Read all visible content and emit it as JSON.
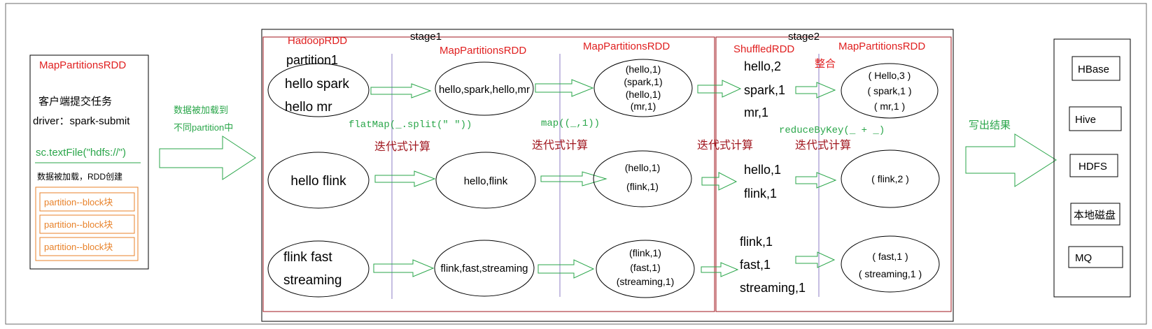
{
  "colors": {
    "red": "#e02020",
    "dark_red": "#a0161e",
    "green": "#2aa64a",
    "orange": "#e8822a",
    "black": "#000000",
    "purple_line": "#b4a8d8",
    "frame": "#6b6b6b"
  },
  "client": {
    "title": "MapPartitionsRDD",
    "submit_line1": "客户端提交任务",
    "submit_line2": "driver：spark-submit",
    "textfile": "sc.textFile(\"hdfs://\")",
    "loaded": "数据被加载，RDD创建",
    "blocks": [
      "partition--block块",
      "partition--block块",
      "partition--block块"
    ]
  },
  "load_arrow": {
    "line1": "数据被加载到",
    "line2": "不同partition中"
  },
  "stage1": {
    "label": "stage1",
    "rdd_hadoop": "HadoopRDD",
    "partition_label": "partition1",
    "rdd_map1": "MapPartitionsRDD",
    "rdd_map2": "MapPartitionsRDD",
    "op_flatmap": "flatMap(_.split(\" \"))",
    "op_map": "map((_,1))",
    "iter1": "迭代式计算",
    "iter2": "迭代式计算",
    "input": [
      [
        "hello spark",
        "hello mr"
      ],
      [
        "hello flink"
      ],
      [
        "flink fast",
        "streaming"
      ]
    ],
    "words": [
      [
        "hello,spark,hello,mr"
      ],
      [
        "hello,flink"
      ],
      [
        "flink,fast,streaming"
      ]
    ],
    "pairs": [
      [
        "(hello,1)",
        "(spark,1)",
        "(hello,1)",
        "(mr,1)"
      ],
      [
        "(hello,1)",
        "(flink,1)"
      ],
      [
        "(flink,1)",
        "(fast,1)",
        "(streaming,1)"
      ]
    ]
  },
  "stage2": {
    "label": "stage2",
    "rdd_shuffled": "ShuffledRDD",
    "rdd_map": "MapPartitionsRDD",
    "merge": "整合",
    "op_reduce": "reduceByKey(_ + _)",
    "iter1": "迭代式计算",
    "iter2": "迭代式计算",
    "shuffled": [
      [
        "hello,2",
        "spark,1",
        "mr,1"
      ],
      [
        "hello,1",
        "flink,1"
      ],
      [
        "flink,1",
        "fast,1",
        "streaming,1"
      ]
    ],
    "results": [
      [
        "( Hello,3 )",
        "( spark,1 )",
        "( mr,1 )"
      ],
      [
        "( flink,2 )"
      ],
      [
        "( fast,1 )",
        "( streaming,1 )"
      ]
    ]
  },
  "output_arrow": {
    "label": "写出结果"
  },
  "sinks": [
    "HBase",
    "Hive",
    "HDFS",
    "本地磁盘",
    "MQ"
  ]
}
